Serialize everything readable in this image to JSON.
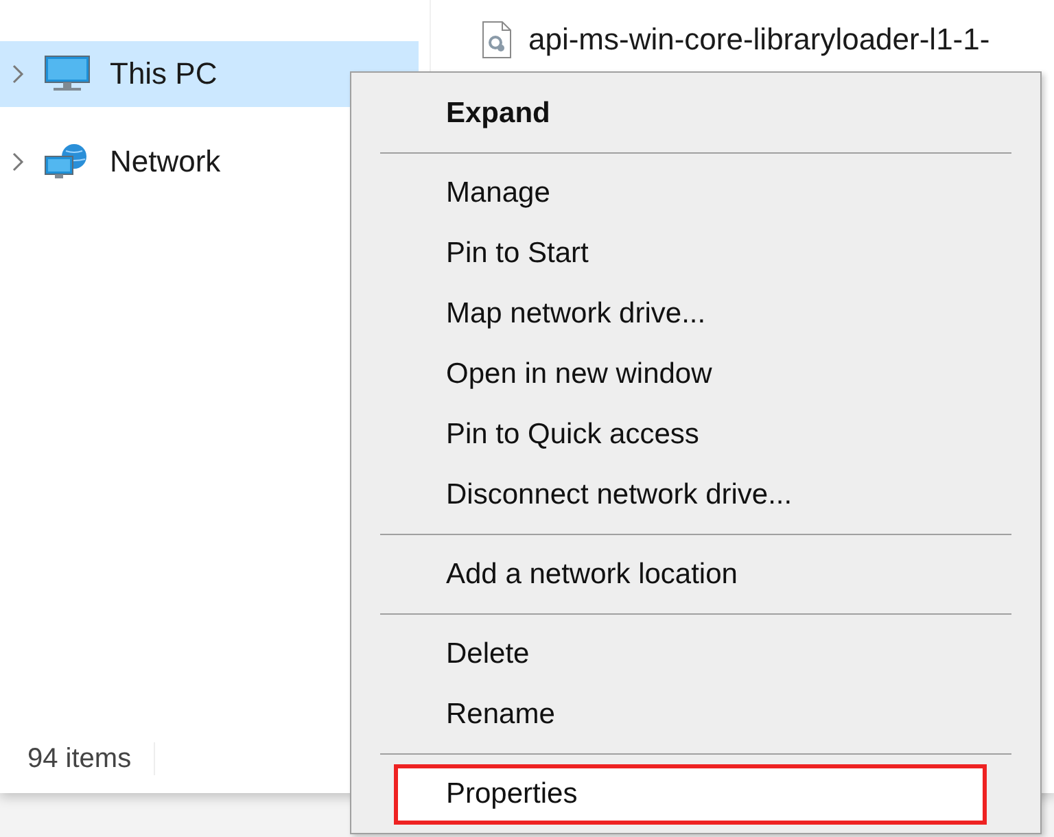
{
  "sidebar": {
    "items": [
      {
        "label": "This PC",
        "kind": "computer",
        "selected": true
      },
      {
        "label": "Network",
        "kind": "network",
        "selected": false
      }
    ]
  },
  "file_list": {
    "items": [
      {
        "name": "api-ms-win-core-libraryloader-l1-1-"
      }
    ]
  },
  "status_bar": {
    "item_count": "94 items"
  },
  "context_menu": {
    "groups": [
      [
        {
          "label": "Expand",
          "default": true,
          "highlighted": false
        }
      ],
      [
        {
          "label": "Manage",
          "default": false,
          "highlighted": false
        },
        {
          "label": "Pin to Start",
          "default": false,
          "highlighted": false
        },
        {
          "label": "Map network drive...",
          "default": false,
          "highlighted": false
        },
        {
          "label": "Open in new window",
          "default": false,
          "highlighted": false
        },
        {
          "label": "Pin to Quick access",
          "default": false,
          "highlighted": false
        },
        {
          "label": "Disconnect network drive...",
          "default": false,
          "highlighted": false
        }
      ],
      [
        {
          "label": "Add a network location",
          "default": false,
          "highlighted": false
        }
      ],
      [
        {
          "label": "Delete",
          "default": false,
          "highlighted": false
        },
        {
          "label": "Rename",
          "default": false,
          "highlighted": false
        }
      ],
      [
        {
          "label": "Properties",
          "default": false,
          "highlighted": true
        }
      ]
    ]
  }
}
